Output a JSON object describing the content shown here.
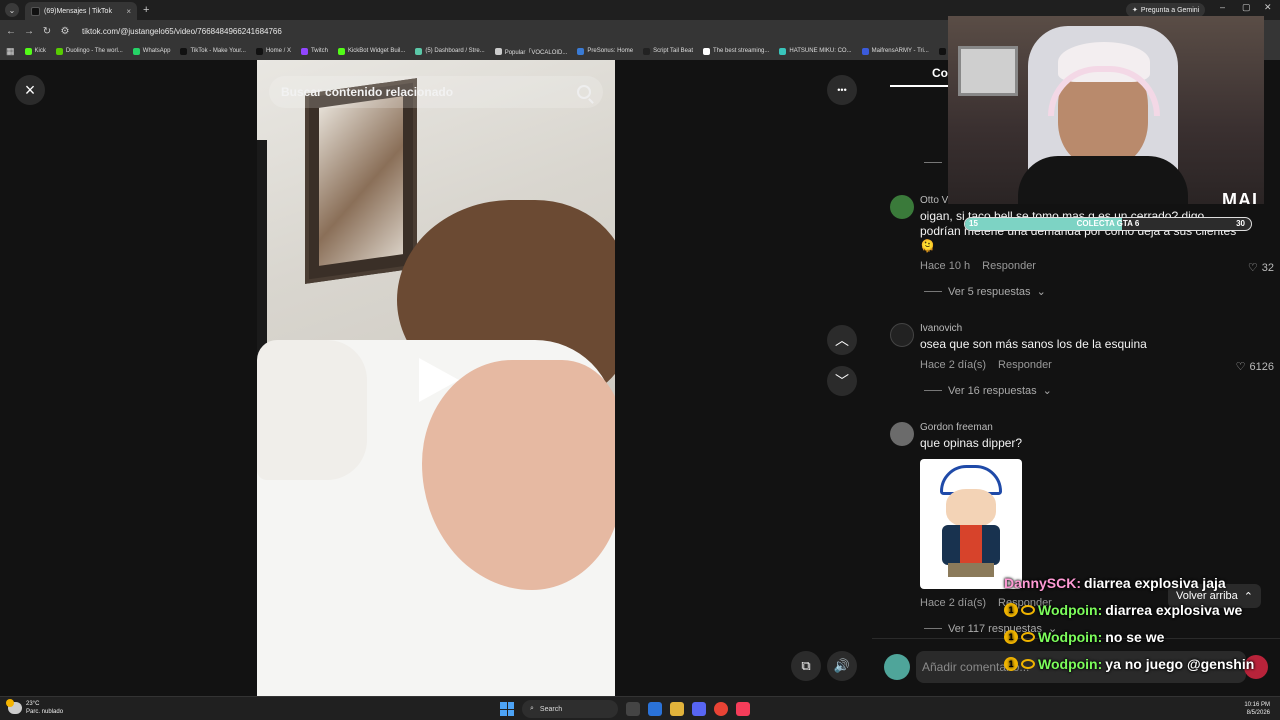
{
  "browser": {
    "tab_title": "(69)Mensajes | TikTok",
    "url": "tiktok.com/@justangelo65/video/7668484966241684766",
    "gemini_label": "Pregunta a Gemini",
    "bookmarks": [
      {
        "label": "Kick",
        "color": "#53fc18"
      },
      {
        "label": "Duolingo - The worl...",
        "color": "#58cc02"
      },
      {
        "label": "WhatsApp",
        "color": "#25d366"
      },
      {
        "label": "TikTok - Make Your...",
        "color": "#111111"
      },
      {
        "label": "Home / X",
        "color": "#111111"
      },
      {
        "label": "Twitch",
        "color": "#9146ff"
      },
      {
        "label": "KickBot Widget Buil...",
        "color": "#53fc18"
      },
      {
        "label": "(5) Dashboard / Stre...",
        "color": "#5bc8a8"
      },
      {
        "label": "Popular「VOCALOID...",
        "color": "#cccccc"
      },
      {
        "label": "PreSonus: Home",
        "color": "#3a7bd5"
      },
      {
        "label": "Script Tail Beat",
        "color": "#222222"
      },
      {
        "label": "The best streaming...",
        "color": "#ffffff"
      },
      {
        "label": "HATSUNE MIKU: CO...",
        "color": "#39c5bb"
      },
      {
        "label": "MaifrensARMY - Tri...",
        "color": "#3b5bdb"
      },
      {
        "label": "Inicio",
        "color": "#111111"
      }
    ]
  },
  "video_view": {
    "search_placeholder": "Buscar contenido relacionado",
    "close_icon": "×",
    "more_icon": "•••",
    "up_icon": "⌃",
    "down_icon": "⌄"
  },
  "comments_panel": {
    "tab_label": "Comentarios",
    "comments": [
      {
        "user": "Otto Von Bulnes",
        "text": "oigan, si taco bell se tomo mas q es un cerrado? digo, podrían meterle una demanda por como deja a sus clientes 🫠",
        "time": "Hace 10 h",
        "reply_label": "Responder",
        "likes": "32",
        "replies": "Ver 5 respuestas",
        "avatar_color": "#3a7a3a"
      },
      {
        "user": "Ivanovich",
        "text": "osea que son más sanos los de la esquina",
        "time": "Hace 2 día(s)",
        "reply_label": "Responder",
        "likes": "6126",
        "replies": "Ver 16 respuestas",
        "avatar_color": "#222222"
      },
      {
        "user": "Gordon freeman",
        "text": "que opinas dipper?",
        "time": "Hace 2 día(s)",
        "reply_label": "Responder",
        "likes": "",
        "replies": "Ver 117 respuestas",
        "avatar_color": "#6b6b6b"
      }
    ],
    "back_to_top": "Volver arriba",
    "add_comment_placeholder": "Añadir comentario..."
  },
  "stream_overlay": {
    "goal_label": "COLECTA GTA 6",
    "goal_left": "15",
    "goal_right": "30",
    "goal_fill": 0.55,
    "logo_text": "MAI",
    "chat": [
      {
        "user": "DannySCK:",
        "message": "diarrea explosiva jaja",
        "color": "#ff9ad5"
      },
      {
        "user": "Wodpoin:",
        "message": "diarrea explosiva we",
        "color": "#7cfc5b"
      },
      {
        "user": "Wodpoin:",
        "message": "no se we",
        "color": "#7cfc5b"
      },
      {
        "user": "Wodpoin:",
        "message": "ya no juego @genshin",
        "color": "#7cfc5b"
      }
    ]
  },
  "taskbar": {
    "temperature": "23°C",
    "weather_desc": "Parc. nublado",
    "search_label": "Search",
    "time": "10:16 PM",
    "date": "8/5/2026"
  }
}
